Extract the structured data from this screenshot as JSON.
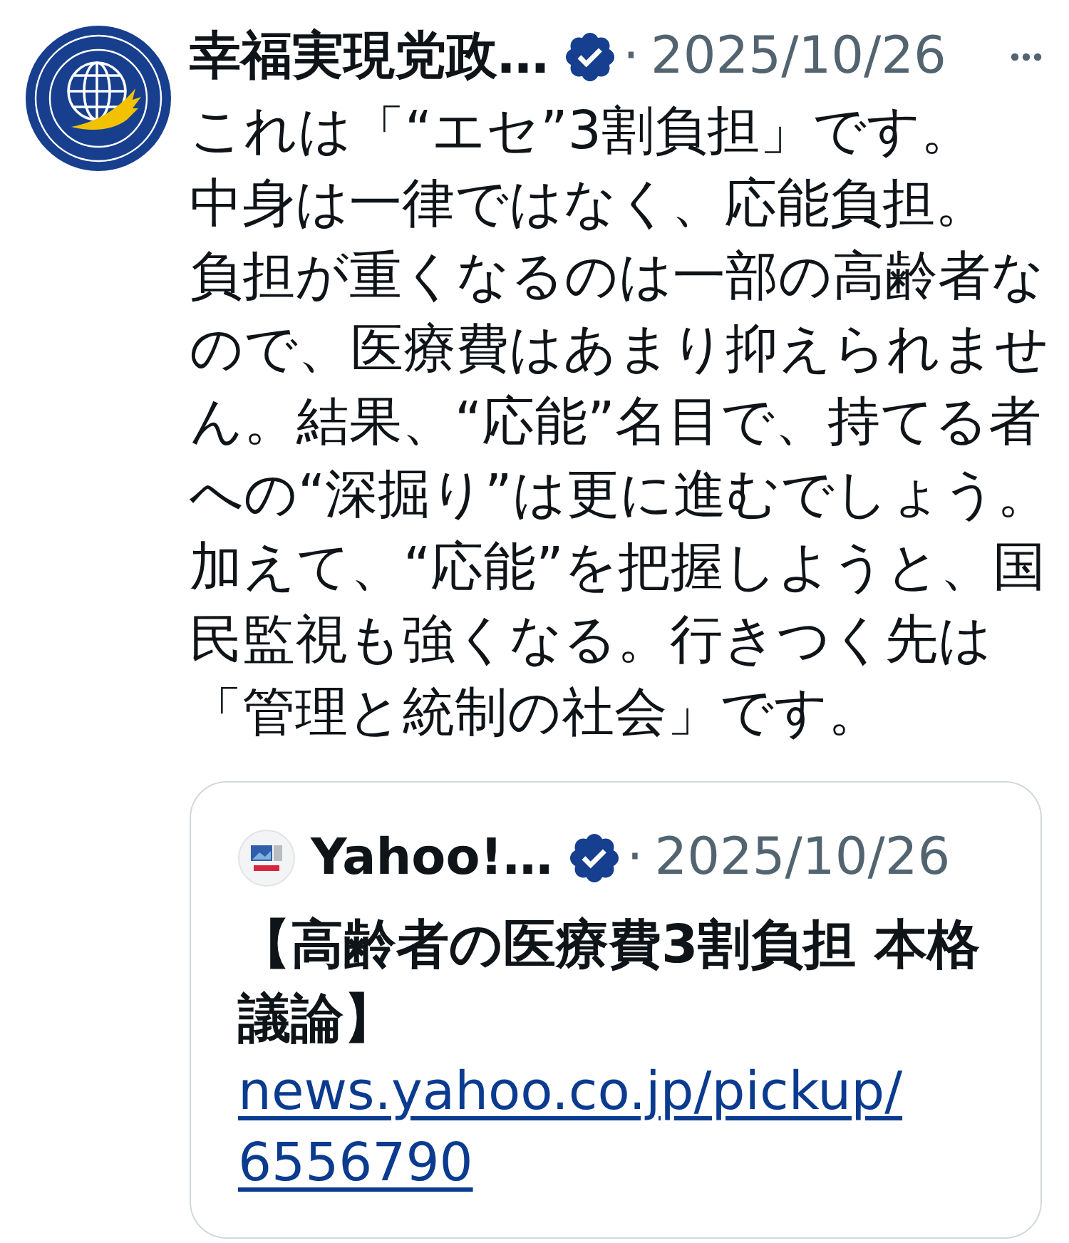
{
  "post": {
    "author": {
      "name": "幸福実現党政…",
      "verified": true
    },
    "separator": "·",
    "date": "2025/10/26",
    "paragraphs": [
      "これは「“エセ”3割負担」です。",
      "中身は一律ではなく、応能負担。",
      "負担が重くなるのは一部の高齢者なので、医療費はあまり抑えられません。結果、“応能”名目で、持てる者への“深掘り”は更に進むでしょう。加えて、“応能”を把握しようと、国民監視も強くなる。行きつく先は「管理と統制の社会」です。"
    ],
    "quote": {
      "author": {
        "name": "Yahoo!…",
        "verified": true
      },
      "separator": "·",
      "date": "2025/10/26",
      "title": "【高齢者の医療費3割負担 本格議論】",
      "link": "news.yahoo.co.jp/pickup/6556790"
    }
  }
}
